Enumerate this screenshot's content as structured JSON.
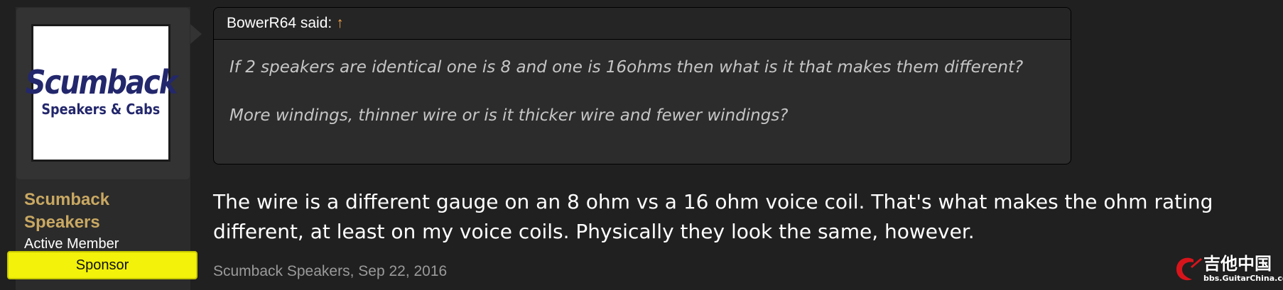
{
  "sidebar": {
    "avatar_logo": {
      "main": "Scumback",
      "sub": "Speakers & Cabs"
    },
    "user_name": "Scumback Speakers",
    "user_title": "Active Member",
    "badge": "Sponsor",
    "name_color": "#c9a862",
    "badge_color": "#f2f20a"
  },
  "quote": {
    "author_said": "BowerR64 said:",
    "jump_icon": "↑",
    "lines": [
      "If 2 speakers are identical one is 8 and one is 16ohms then what is it that makes them different?",
      "More windings, thinner wire or is it thicker wire and fewer windings?"
    ]
  },
  "post": {
    "body": "The wire is a different gauge on an 8 ohm vs a 16 ohm voice coil. That's what makes the ohm rating different, at least on my voice coils. Physically they look the same, however.",
    "author": "Scumback Speakers",
    "date": "Sep 22, 2016"
  },
  "watermark": {
    "cn": "吉他中国",
    "url": "bbs.GuitarChina.com"
  },
  "colors": {
    "background": "#202020",
    "quote_bg": "#2c2c2c",
    "accent_arrow": "#f0a24a"
  }
}
